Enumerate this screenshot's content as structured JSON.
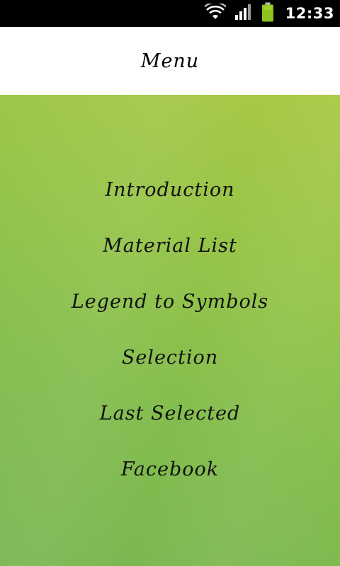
{
  "status_bar": {
    "time": "12:33",
    "icons": [
      "wifi-icon",
      "signal-icon",
      "battery-icon"
    ],
    "battery_color": "#8ec21f"
  },
  "header": {
    "title": "Menu"
  },
  "menu": {
    "items": [
      {
        "label": "Introduction"
      },
      {
        "label": "Material List"
      },
      {
        "label": "Legend to Symbols"
      },
      {
        "label": "Selection"
      },
      {
        "label": "Last Selected"
      },
      {
        "label": "Facebook"
      }
    ]
  },
  "colors": {
    "background_gradient_start": "#a9c944",
    "background_gradient_end": "#79b651",
    "header_background": "#ffffff",
    "status_bar_background": "#000000"
  }
}
